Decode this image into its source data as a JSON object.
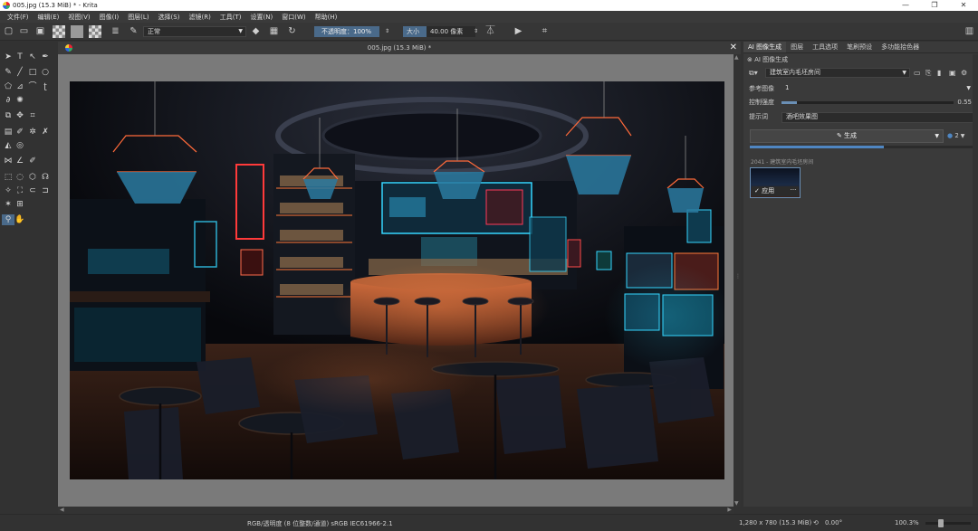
{
  "window": {
    "title": "005.jpg (15.3 MiB) * - Krita",
    "minimize": "—",
    "maximize": "❐",
    "close": "✕"
  },
  "menu": [
    "文件(F)",
    "编辑(E)",
    "视图(V)",
    "图像(I)",
    "图层(L)",
    "选择(S)",
    "滤镜(R)",
    "工具(T)",
    "设置(N)",
    "窗口(W)",
    "帮助(H)"
  ],
  "toolbar": {
    "blend_mode": "正常",
    "opacity_label": "不透明度：100%",
    "size_label": "大小",
    "size_value": "40.00 像素"
  },
  "canvas": {
    "tab_title": "005.jpg (15.3 MiB) *",
    "close": "✕"
  },
  "docker": {
    "tabs": [
      "AI 图像生成",
      "图层",
      "工具选项",
      "笔刷预设",
      "多功能拾色器"
    ],
    "heading": "AI 图像生成",
    "style_preset": "建筑室内毛坯房间",
    "ref_image_label": "参考图像",
    "ref_image_value": "1",
    "strength_label": "控制强度",
    "strength_value": "0.55",
    "prompt_label": "提示词",
    "prompt_value": "酒吧效果图",
    "generate_label": "生成",
    "batch_count": "2",
    "progress": 0.6,
    "history_label": "2041 - 建筑室内毛坯房间",
    "apply_label": "✓ 应用",
    "more_label": "···"
  },
  "status": {
    "color_info": "RGB/透明度 (8 位整数/通道)  sRGB IEC61966-2.1",
    "dimensions": "1,280 x 780 (15.3 MiB)",
    "rotation": "0.00°",
    "zoom": "100.3%"
  },
  "colors": {
    "accent": "#4a6a8a",
    "neon_red": "#ff3a3a",
    "neon_cyan": "#35d6ff",
    "bar_glow": "#ff7a3a"
  }
}
